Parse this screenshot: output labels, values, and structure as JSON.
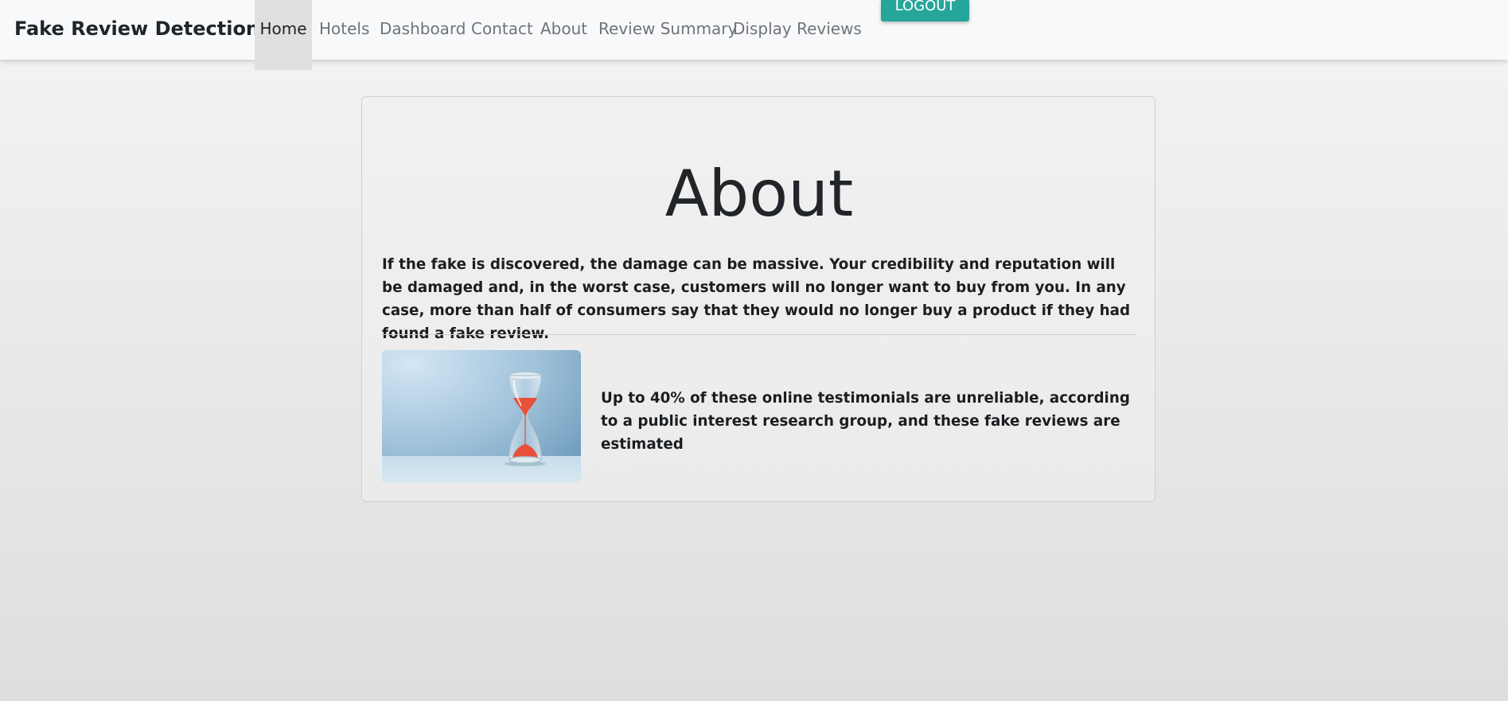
{
  "navbar": {
    "brand": "Fake Review Detection",
    "items": [
      {
        "label": "Home",
        "active": true
      },
      {
        "label": "Hotels",
        "active": false
      },
      {
        "label": "Dashboard",
        "active": false
      },
      {
        "label": "Contact",
        "active": false
      },
      {
        "label": "About",
        "active": false
      },
      {
        "label": "Review Summary",
        "active": false
      },
      {
        "label": "Display Reviews",
        "active": false
      }
    ],
    "logout_label": "LOGOUT"
  },
  "about": {
    "title": "About",
    "paragraph": "If the fake is discovered, the damage can be massive. Your credibility and reputation will be damaged and, in the worst case, customers will no longer want to buy from you. In any case, more than half of consumers say that they would no longer buy a product if they had found a fake review.",
    "image_icon": "hourglass-image",
    "side_text": "Up to 40% of these online testimonials are unreliable, according to a public interest research group, and these fake reviews are estimated"
  },
  "colors": {
    "accent": "#26a69a",
    "navbar_bg": "#f8f9fa",
    "sand": "#e8503a"
  }
}
